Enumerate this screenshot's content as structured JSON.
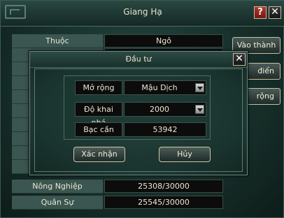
{
  "main": {
    "title": "Giang Hạ",
    "help_icon": "?",
    "close_icon": "✕",
    "rows": [
      {
        "label": "Thuộc",
        "value": "Ngô"
      },
      {
        "label": "",
        "value": ""
      },
      {
        "label": "",
        "value": ""
      },
      {
        "label": "",
        "value": ""
      },
      {
        "label": "",
        "value": ""
      },
      {
        "label": "",
        "value": ""
      },
      {
        "label": "",
        "value": ""
      },
      {
        "label": "",
        "value": ""
      },
      {
        "label": "",
        "value": ""
      },
      {
        "label": "",
        "value": ""
      },
      {
        "label": "Nông Nghiệp",
        "value": "25308/30000"
      },
      {
        "label": "Quân Sự",
        "value": "25545/30000"
      }
    ],
    "side_buttons": [
      {
        "label": "Vào thành"
      },
      {
        "label": "điển"
      },
      {
        "label": "rộng"
      }
    ]
  },
  "dialog": {
    "title": "Đầu tư",
    "close_icon": "✕",
    "fields": [
      {
        "label": "Mở rộng",
        "value": "Mậu Dịch",
        "dropdown": true
      },
      {
        "label": "Độ khai phá",
        "value": "2000",
        "dropdown": true
      },
      {
        "label": "Bạc cần",
        "value": "53942",
        "dropdown": false
      }
    ],
    "confirm_label": "Xác nhận",
    "cancel_label": "Hủy"
  }
}
